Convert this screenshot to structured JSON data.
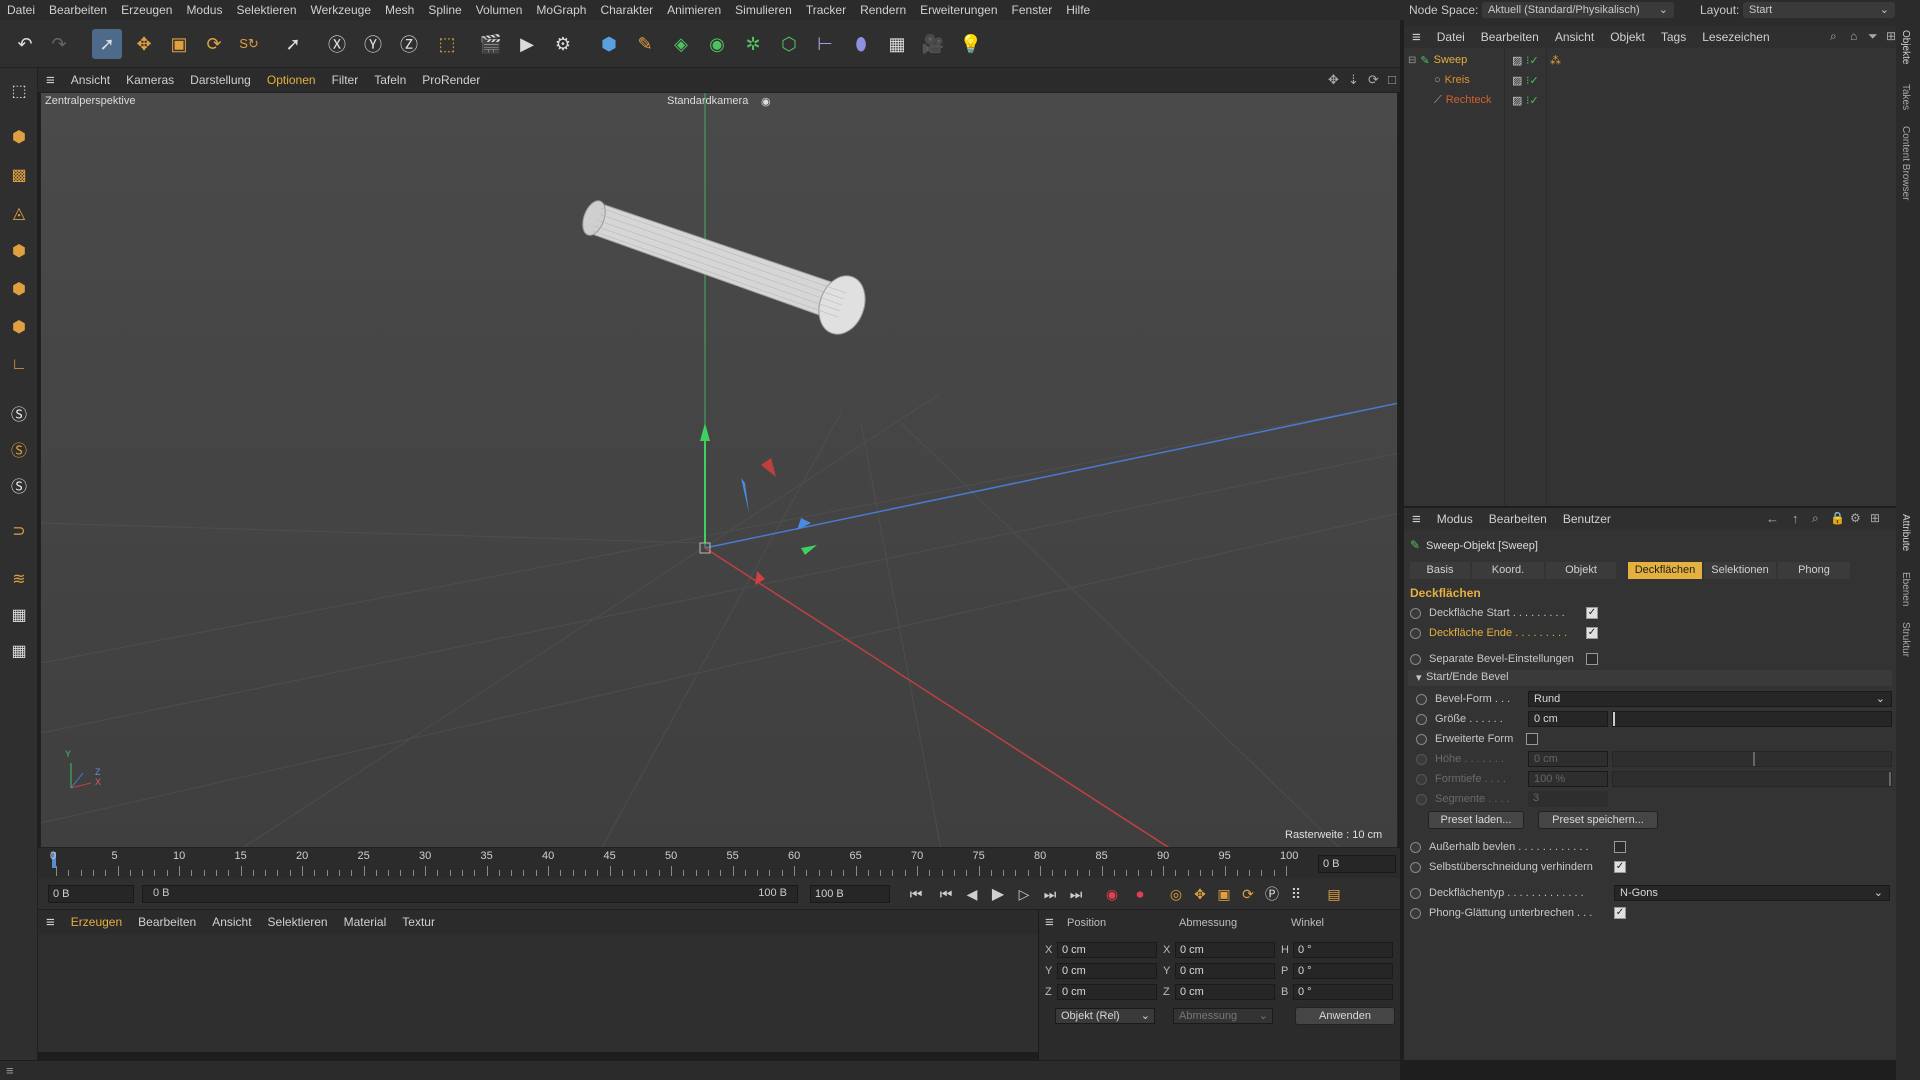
{
  "menubar": {
    "items": [
      "Datei",
      "Bearbeiten",
      "Erzeugen",
      "Modus",
      "Selektieren",
      "Werkzeuge",
      "Mesh",
      "Spline",
      "Volumen",
      "MoGraph",
      "Charakter",
      "Animieren",
      "Simulieren",
      "Tracker",
      "Rendern",
      "Erweiterungen",
      "Fenster",
      "Hilfe"
    ],
    "node_space_label": "Node Space:",
    "node_space_value": "Aktuell (Standard/Physikalisch)",
    "layout_label": "Layout:",
    "layout_value": "Start"
  },
  "viewport": {
    "menu": [
      "Ansicht",
      "Kameras",
      "Darstellung",
      "Optionen",
      "Filter",
      "Tafeln",
      "ProRender"
    ],
    "active_menu": "Optionen",
    "perspective_label": "Zentralperspektive",
    "camera_label": "Standardkamera",
    "grid_label": "Rasterweite : 10 cm",
    "axis_y": "Y",
    "axis_x": "X",
    "axis_z": "Z"
  },
  "timeline": {
    "ticks": [
      "0",
      "5",
      "10",
      "15",
      "20",
      "25",
      "30",
      "35",
      "40",
      "45",
      "50",
      "55",
      "60",
      "65",
      "70",
      "75",
      "80",
      "85",
      "90",
      "95",
      "100"
    ],
    "current_frame": "0 B",
    "start_field": "0 B",
    "range_start": "0 B",
    "range_end": "100 B",
    "end_field": "100 B"
  },
  "material_manager": {
    "menu": [
      "Erzeugen",
      "Bearbeiten",
      "Ansicht",
      "Selektieren",
      "Material",
      "Textur"
    ]
  },
  "coordinates": {
    "col_position": "Position",
    "col_size": "Abmessung",
    "col_angle": "Winkel",
    "rows": [
      {
        "axis": "X",
        "pos": "0 cm",
        "size_axis": "X",
        "size": "0 cm",
        "angle_axis": "H",
        "angle": "0 °"
      },
      {
        "axis": "Y",
        "pos": "0 cm",
        "size_axis": "Y",
        "size": "0 cm",
        "angle_axis": "P",
        "angle": "0 °"
      },
      {
        "axis": "Z",
        "pos": "0 cm",
        "size_axis": "Z",
        "size": "0 cm",
        "angle_axis": "B",
        "angle": "0 °"
      }
    ],
    "mode_dropdown": "Objekt (Rel)",
    "size_dropdown": "Abmessung",
    "apply_button": "Anwenden"
  },
  "object_manager": {
    "menu": [
      "Datei",
      "Bearbeiten",
      "Ansicht",
      "Objekt",
      "Tags",
      "Lesezeichen"
    ],
    "objects": [
      {
        "name": "Sweep",
        "color": "#e4b040"
      },
      {
        "name": "Kreis",
        "color": "#e09030"
      },
      {
        "name": "Rechteck",
        "color": "#d06030"
      }
    ]
  },
  "side_tabs": [
    "Objekte",
    "Takes",
    "Content Browser",
    "Attribute",
    "Ebenen",
    "Struktur"
  ],
  "attributes": {
    "menu": [
      "Modus",
      "Bearbeiten",
      "Benutzer"
    ],
    "object_title": "Sweep-Objekt [Sweep]",
    "tabs": [
      "Basis",
      "Koord.",
      "Objekt",
      "Deckflächen",
      "Selektionen",
      "Phong"
    ],
    "active_tab": "Deckflächen",
    "section_title": "Deckflächen",
    "cap_start_label": "Deckfläche Start . . . . . . . . .",
    "cap_end_label": "Deckfläche Ende . . . . . . . . .",
    "separate_bevel_label": "Separate Bevel-Einstellungen",
    "group_title": "Start/Ende Bevel",
    "bevel_form_label": "Bevel-Form . . .",
    "bevel_form_value": "Rund",
    "size_label": "Größe . . . . . .",
    "size_value": "0 cm",
    "extended_form_label": "Erweiterte Form",
    "height_label": "Höhe . . . . . . .",
    "height_value": "0 cm",
    "depth_label": "Formtiefe . . . .",
    "depth_value": "100 %",
    "segments_label": "Segmente . . . .",
    "segments_value": "3",
    "preset_load": "Preset laden...",
    "preset_save": "Preset speichern...",
    "bevel_outside_label": "Außerhalb bevlen . . . . . . . . . . . .",
    "avoid_self_intersect_label": "Selbstüberschneidung verhindern",
    "cap_type_label": "Deckflächentyp . . . . . . . . . . . . .",
    "cap_type_value": "N-Gons",
    "phong_break_label": "Phong-Glättung unterbrechen . . ."
  }
}
